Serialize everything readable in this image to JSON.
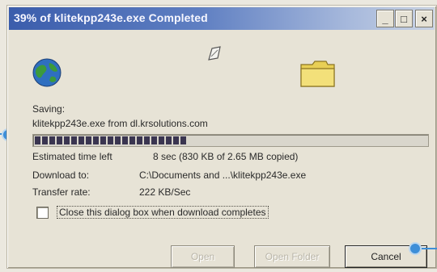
{
  "window": {
    "title": "39% of klitekpp243e.exe Completed",
    "minimize_glyph": "_",
    "maximize_glyph": "□",
    "close_glyph": "×"
  },
  "icons": {
    "source": "globe-icon",
    "transfer": "paper-icon",
    "destination": "folder-icon"
  },
  "download": {
    "saving_label": "Saving:",
    "file_line": "klitekpp243e.exe from dl.krsolutions.com",
    "progress_fraction": 0.39,
    "time_left_label": "Estimated time left",
    "time_left_value": "8 sec (830 KB of 2.65 MB copied)",
    "download_to_label": "Download to:",
    "download_to_value": "C:\\Documents and ...\\klitekpp243e.exe",
    "transfer_rate_label": "Transfer rate:",
    "transfer_rate_value": "222 KB/Sec"
  },
  "options": {
    "close_when_complete_label": "Close this dialog box when download completes",
    "close_when_complete_checked": false
  },
  "buttons": {
    "open_label": "Open",
    "open_folder_label": "Open Folder",
    "cancel_label": "Cancel"
  },
  "colors": {
    "titlebar_start": "#3b5dac",
    "titlebar_end": "#c9d3e4",
    "progress_block": "#3a3550",
    "callout": "#3d8ed8"
  }
}
